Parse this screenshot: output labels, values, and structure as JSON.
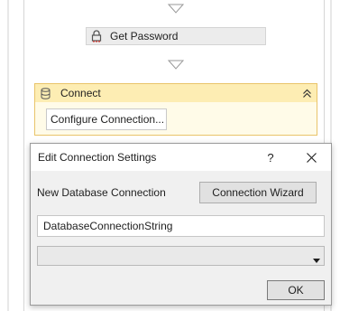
{
  "workflow": {
    "activities": [
      {
        "label": "Get Password",
        "icon": "lock-icon"
      },
      {
        "label": "Connect",
        "icon": "database-icon",
        "collapse_icon": "double-chevron-up-icon",
        "configure_label": "Configure Connection..."
      }
    ],
    "colors": {
      "connect_header_bg": "#fdedb3",
      "connect_border": "#e9c46a",
      "activity_bg": "#ececec"
    }
  },
  "dialog": {
    "title": "Edit Connection Settings",
    "help_label": "?",
    "close_icon": "close-icon",
    "new_db_label": "New Database Connection",
    "wizard_label": "Connection Wizard",
    "connection_string_value": "DatabaseConnectionString",
    "provider_selected": "",
    "ok_label": "OK"
  }
}
